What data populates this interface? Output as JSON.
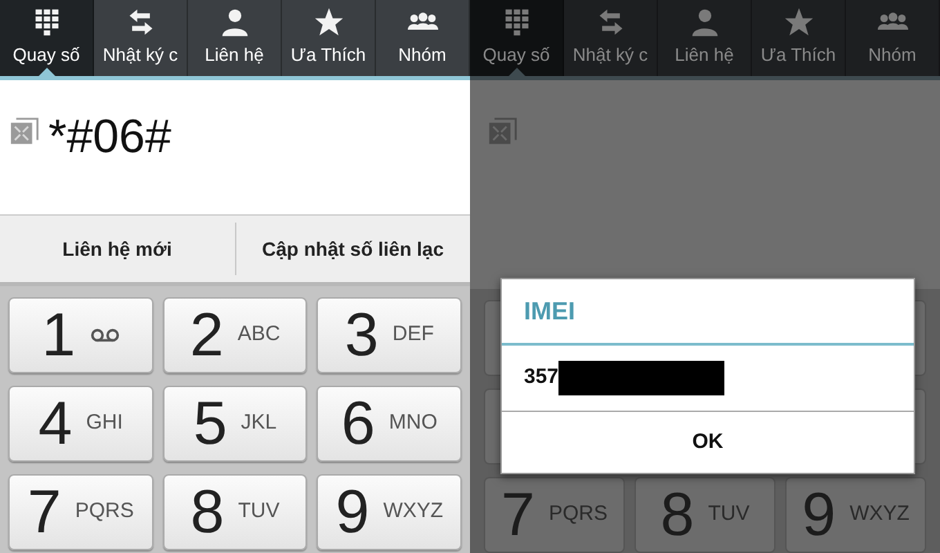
{
  "panels": [
    {
      "kind": "dialer",
      "dimmed": false,
      "tabs": [
        {
          "label": "Quay số",
          "selected": true
        },
        {
          "label": "Nhật ký c",
          "selected": false
        },
        {
          "label": "Liên hệ",
          "selected": false
        },
        {
          "label": "Ưa Thích",
          "selected": false
        },
        {
          "label": "Nhóm",
          "selected": false
        }
      ],
      "dialed": "*#06#",
      "actions": [
        "Liên hệ mới",
        "Cập nhật số liên lạc"
      ],
      "keys": [
        {
          "kind": "voicemail",
          "digit": "1"
        },
        {
          "kind": "letters",
          "digit": "2",
          "letters": "ABC"
        },
        {
          "kind": "letters",
          "digit": "3",
          "letters": "DEF"
        },
        {
          "kind": "letters",
          "digit": "4",
          "letters": "GHI"
        },
        {
          "kind": "letters",
          "digit": "5",
          "letters": "JKL"
        },
        {
          "kind": "letters",
          "digit": "6",
          "letters": "MNO"
        },
        {
          "kind": "letters",
          "digit": "7",
          "letters": "PQRS"
        },
        {
          "kind": "letters",
          "digit": "8",
          "letters": "TUV"
        },
        {
          "kind": "letters",
          "digit": "9",
          "letters": "WXYZ"
        }
      ]
    },
    {
      "kind": "dialog",
      "dimmed": true,
      "tabs": [
        {
          "label": "Quay số",
          "selected": true
        },
        {
          "label": "Nhật ký c",
          "selected": false
        },
        {
          "label": "Liên hệ",
          "selected": false
        },
        {
          "label": "Ưa Thích",
          "selected": false
        },
        {
          "label": "Nhóm",
          "selected": false
        }
      ],
      "keys": [
        {
          "kind": "letters",
          "digit": "7",
          "letters": "PQRS"
        },
        {
          "kind": "letters",
          "digit": "8",
          "letters": "TUV"
        },
        {
          "kind": "letters",
          "digit": "9",
          "letters": "WXYZ"
        }
      ],
      "dialog": {
        "title": "IMEI",
        "value": "357",
        "button": "OK"
      }
    }
  ]
}
